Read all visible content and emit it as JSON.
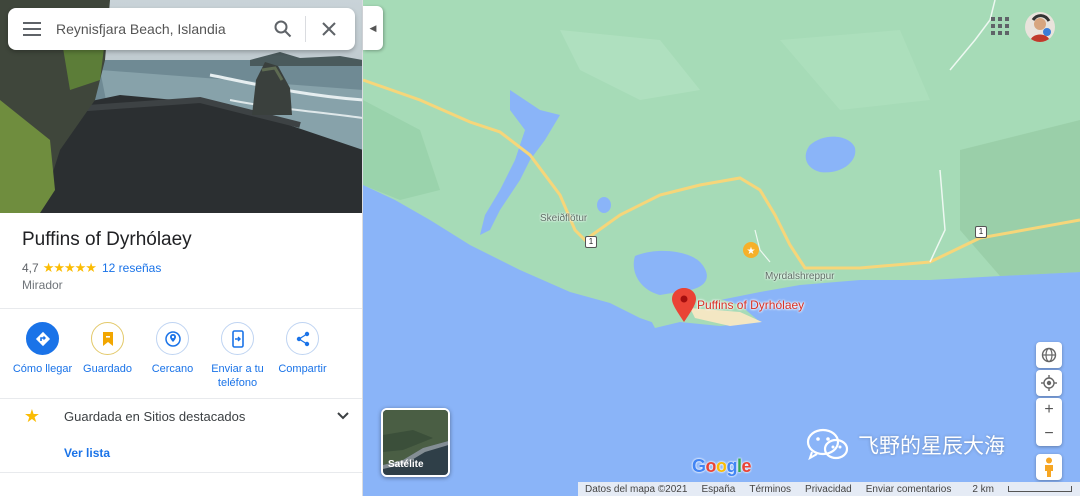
{
  "search": {
    "value": "Reynisfjara Beach, Islandia"
  },
  "place": {
    "name": "Puffins of Dyrhólaey",
    "rating": "4,7",
    "stars": "★★★★★",
    "reviews": "12 reseñas",
    "category": "Mirador"
  },
  "actions": [
    {
      "label": "Cómo llegar",
      "icon": "directions-icon"
    },
    {
      "label": "Guardado",
      "icon": "bookmark-icon"
    },
    {
      "label": "Cercano",
      "icon": "nearby-icon"
    },
    {
      "label": "Enviar a tu teléfono",
      "icon": "send-to-phone-icon"
    },
    {
      "label": "Compartir",
      "icon": "share-icon"
    }
  ],
  "saved": {
    "text": "Guardada en Sitios destacados",
    "view_list": "Ver lista"
  },
  "map": {
    "labels": {
      "skeidflotur": "Skeiðflötur",
      "myrdalshreppur": "Myrdalshreppur",
      "poi": "Puffins of Dyrhólaey",
      "road1a": "1",
      "road1b": "1"
    },
    "layer_button": "Satélite",
    "google_logo": "Google",
    "watermark": "飞野的星辰大海"
  },
  "footer": {
    "data": "Datos del mapa ©2021",
    "country": "España",
    "terms": "Términos",
    "privacy": "Privacidad",
    "feedback": "Enviar comentarios",
    "scale": "2 km"
  },
  "colors": {
    "land": "#9fd8b3",
    "water": "#8ab4f8",
    "road": "#f6d67a",
    "accent": "#1a73e8",
    "pin": "#ea4335"
  }
}
